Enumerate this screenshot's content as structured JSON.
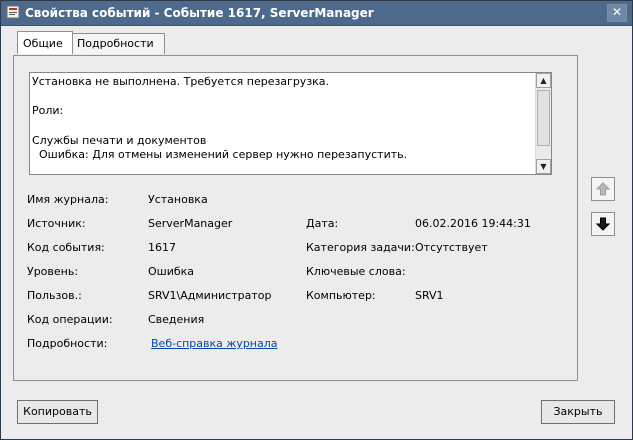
{
  "window": {
    "title": "Свойства событий - Событие 1617, ServerManager",
    "close_glyph": "✕"
  },
  "tabs": [
    {
      "label": "Общие"
    },
    {
      "label": "Подробности"
    }
  ],
  "description": {
    "lines": [
      "Установка не выполнена. Требуется перезагрузка.",
      "",
      "Роли:",
      "",
      "Службы печати и документов",
      "  Ошибка: Для отмены изменений сервер нужно перезапустить."
    ]
  },
  "fields": {
    "log_name": {
      "label": "Имя журнала:",
      "value": "Установка"
    },
    "source": {
      "label": "Источник:",
      "value": "ServerManager"
    },
    "date": {
      "label": "Дата:",
      "value": "06.02.2016 19:44:31"
    },
    "event_id": {
      "label": "Код события:",
      "value": "1617"
    },
    "task_category": {
      "label": "Категория задачи:",
      "value": "Отсутствует"
    },
    "level": {
      "label": "Уровень:",
      "value": "Ошибка"
    },
    "keywords": {
      "label": "Ключевые слова:",
      "value": ""
    },
    "user": {
      "label": "Пользов.:",
      "value": "SRV1\\Администратор"
    },
    "computer": {
      "label": "Компьютер:",
      "value": "SRV1"
    },
    "opcode": {
      "label": "Код операции:",
      "value": "Сведения"
    },
    "more_info": {
      "label": "Подробности:",
      "value": "Веб-справка журнала"
    }
  },
  "icons": {
    "up": "arrow-up-icon",
    "down": "arrow-down-icon"
  },
  "buttons": {
    "copy": "Копировать",
    "close": "Закрыть"
  }
}
